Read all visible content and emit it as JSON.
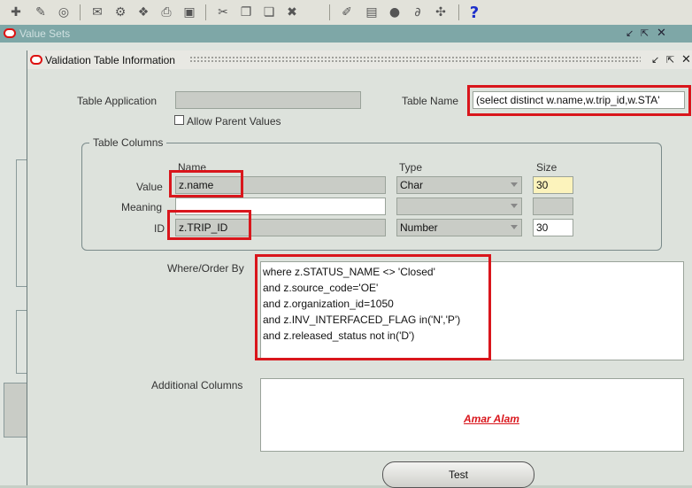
{
  "toolbar": {
    "icons": [
      "new-icon",
      "flashlight-icon",
      "navigate-icon",
      "save-icon",
      "print-setup-icon",
      "copy-icon",
      "print-icon",
      "close-form-icon",
      "cut-icon",
      "copy-doc-icon",
      "paste-icon",
      "clear-icon",
      "edit-pen-icon",
      "attach-icon",
      "globe-icon",
      "clip-icon",
      "tools-icon",
      "help-icon"
    ],
    "help_glyph": "?"
  },
  "bg_window": {
    "title": "Value Sets"
  },
  "dialog": {
    "title": "Validation Table Information",
    "table_application_label": "Table Application",
    "table_application_value": "",
    "allow_parent_label": "Allow Parent Values",
    "table_name_label": "Table Name",
    "table_name_value": "(select  distinct w.name,w.trip_id,w.STA'",
    "table_columns": {
      "legend": "Table Columns",
      "headers": {
        "name": "Name",
        "type": "Type",
        "size": "Size"
      },
      "rows": [
        {
          "label": "Value",
          "name": "z.name",
          "type": "Char",
          "size": "30"
        },
        {
          "label": "Meaning",
          "name": "",
          "type": "",
          "size": ""
        },
        {
          "label": "ID",
          "name": "z.TRIP_ID",
          "type": "Number",
          "size": "30"
        }
      ]
    },
    "where_label": "Where/Order By",
    "where_lines": [
      "where z.STATUS_NAME <> 'Closed'",
      "and z.source_code='OE'",
      "and z.organization_id=1050",
      "and z.INV_INTERFACED_FLAG in('N','P')",
      "and z.released_status not in('D')"
    ],
    "additional_label": "Additional Columns",
    "signature": "Amar Alam",
    "test_button": "Test"
  },
  "colors": {
    "highlight": "#d9161c",
    "title_bar": "#7ea7a7"
  }
}
